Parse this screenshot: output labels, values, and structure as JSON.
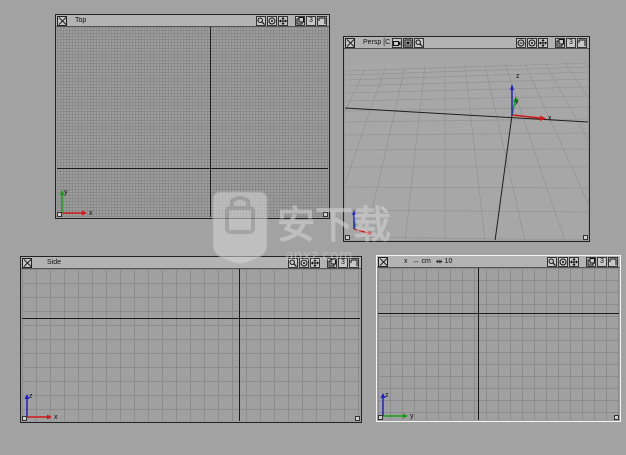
{
  "viewports": {
    "top": {
      "title": "Top",
      "views_count": "3",
      "axis_labels": {
        "x": "x",
        "y": "y"
      }
    },
    "persp": {
      "title": "Persp [C",
      "views_count": "3",
      "axis_labels": {
        "x": "x",
        "y": "y",
        "z": "z"
      }
    },
    "side": {
      "title": "Side",
      "views_count": "3",
      "axis_labels": {
        "x": "x",
        "z": "z"
      }
    },
    "front": {
      "title": "x",
      "unit": "cm",
      "grid_size": "10",
      "views_count": "3",
      "axis_labels": {
        "y": "y",
        "z": "z"
      }
    }
  },
  "colors": {
    "workspace": "#a2a2a2",
    "axis_x": "#d01818",
    "axis_y": "#18a018",
    "axis_z": "#2020c8",
    "active_border": "#f4f4f4"
  },
  "watermark": {
    "text": "安下载",
    "sub": "anxz.com"
  }
}
